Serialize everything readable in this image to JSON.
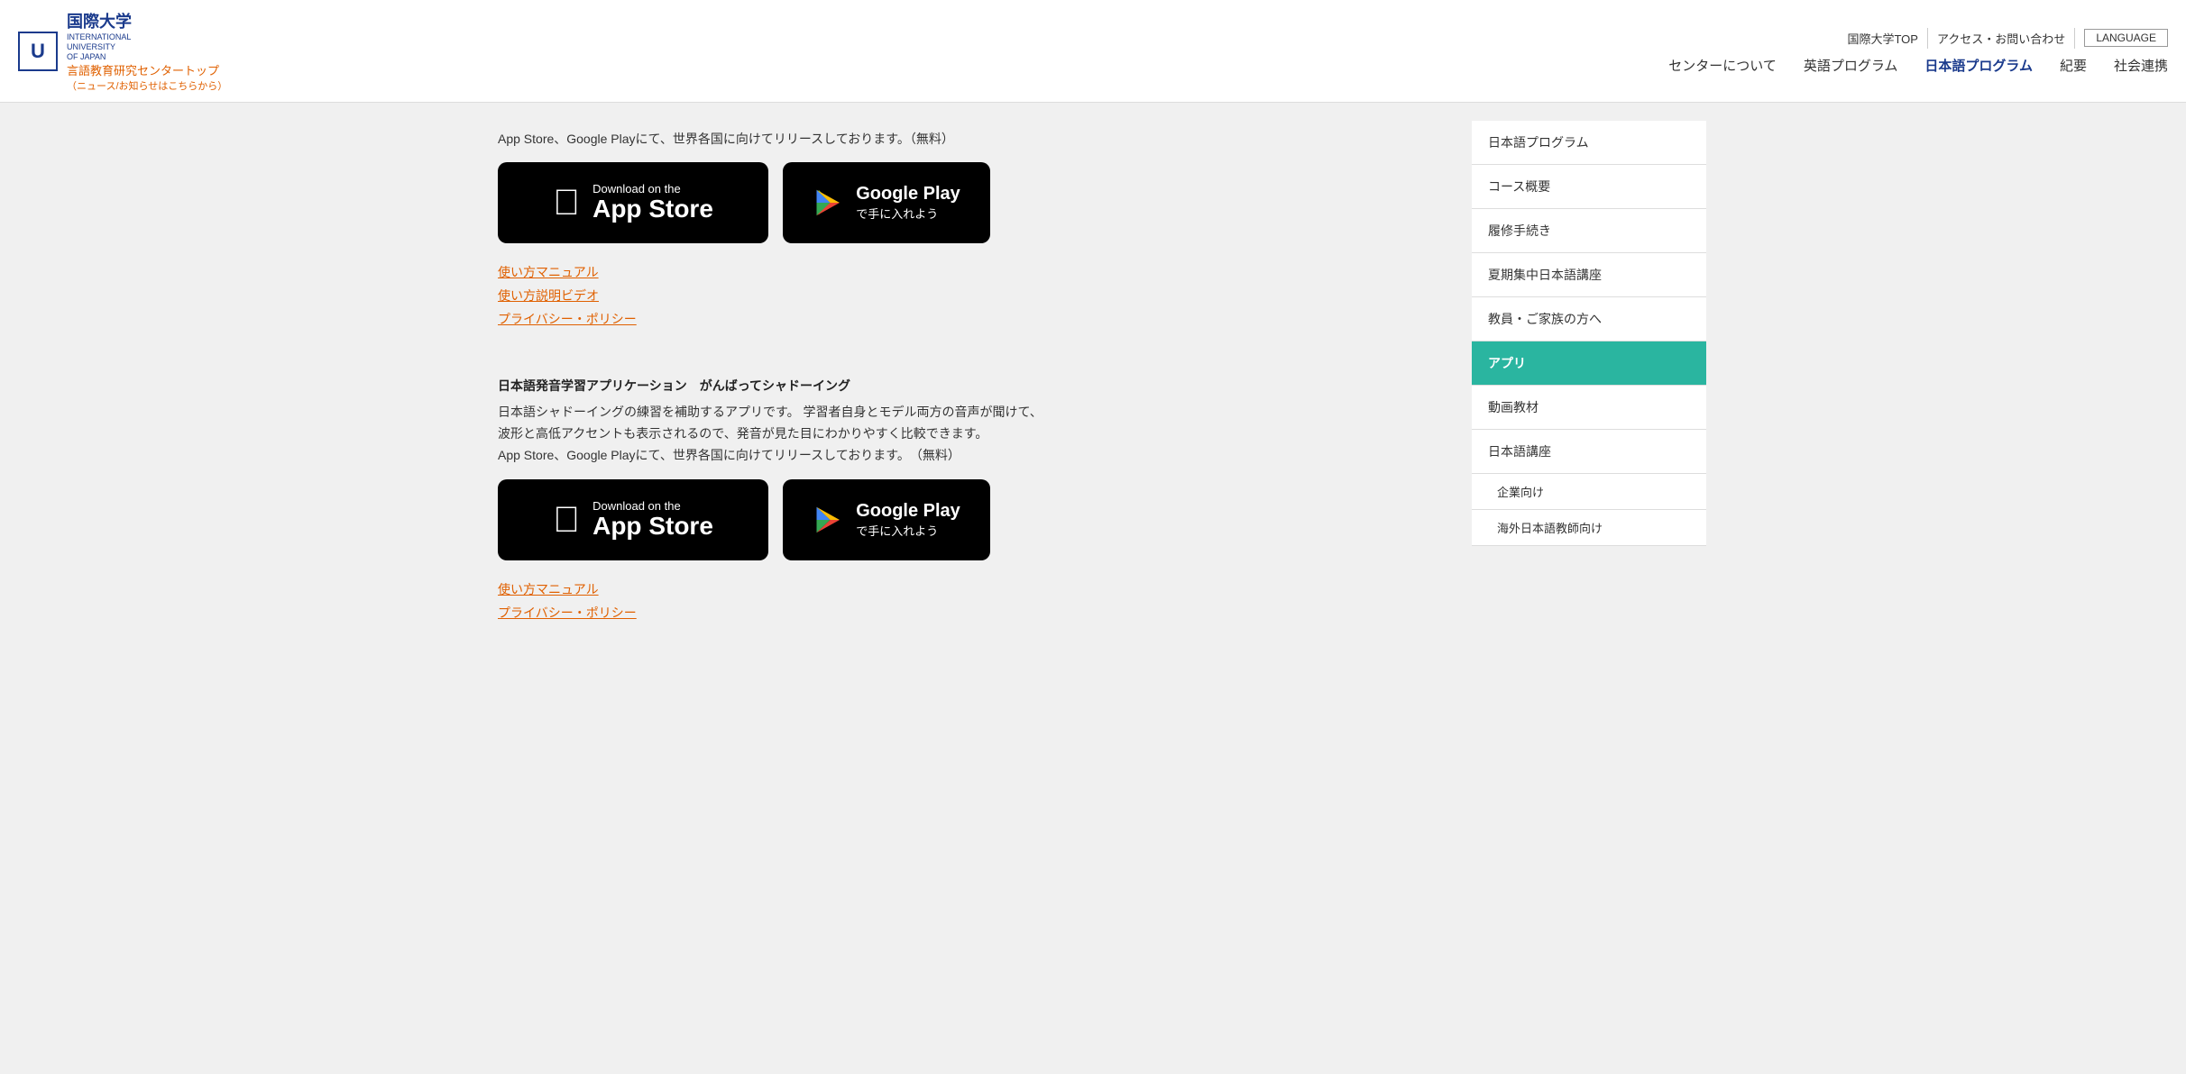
{
  "header": {
    "logo_char": "U",
    "univ_name": "国際大学",
    "univ_en_line1": "INTERNATIONAL",
    "univ_en_line2": "UNIVERSITY",
    "univ_en_line3": "OF JAPAN",
    "center_name": "言語教育研究センタートップ",
    "center_sub": "（ニュース/お知らせはこちらから）",
    "top_links": [
      "国際大学TOP",
      "アクセス・お問い合わせ"
    ],
    "lang_btn": "LANGUAGE",
    "nav": [
      {
        "label": "センターについて",
        "active": false
      },
      {
        "label": "英語プログラム",
        "active": false
      },
      {
        "label": "日本語プログラム",
        "active": true
      },
      {
        "label": "紀要",
        "active": false
      },
      {
        "label": "社会連携",
        "active": false
      }
    ]
  },
  "main": {
    "section1": {
      "intro": "App Store、Google Playにて、世界各国に向けてリリースしております。（無料）",
      "app_store_label_small": "Download on the",
      "app_store_label_big": "App Store",
      "google_play_label_big": "Google Play",
      "google_play_label_small": "で手に入れよう",
      "links": [
        {
          "label": "使い方マニュアル"
        },
        {
          "label": "使い方説明ビデオ"
        },
        {
          "label": "プライバシー・ポリシー"
        }
      ]
    },
    "section2": {
      "title": "日本語発音学習アプリケーション　がんばってシャドーイング",
      "desc_lines": [
        "日本語シャドーイングの練習を補助するアプリです。 学習者自身とモデル両方の音声が聞けて、",
        "波形と高低アクセントも表示されるので、発音が見た目にわかりやすく比較できます。",
        "App Store、Google Playにて、世界各国に向けてリリースしております。　（無料）"
      ],
      "app_store_label_small": "Download on the",
      "app_store_label_big": "App Store",
      "google_play_label_big": "Google Play",
      "google_play_label_small": "で手に入れよう",
      "links": [
        {
          "label": "使い方マニュアル"
        },
        {
          "label": "プライバシー・ポリシー"
        }
      ]
    }
  },
  "sidebar": {
    "items": [
      {
        "label": "日本語プログラム",
        "active": false,
        "sub": false
      },
      {
        "label": "コース概要",
        "active": false,
        "sub": false
      },
      {
        "label": "履修手続き",
        "active": false,
        "sub": false
      },
      {
        "label": "夏期集中日本語講座",
        "active": false,
        "sub": false
      },
      {
        "label": "教員・ご家族の方へ",
        "active": false,
        "sub": false
      },
      {
        "label": "アプリ",
        "active": true,
        "sub": false
      },
      {
        "label": "動画教材",
        "active": false,
        "sub": false
      },
      {
        "label": "日本語講座",
        "active": false,
        "sub": false
      },
      {
        "label": "企業向け",
        "active": false,
        "sub": true
      },
      {
        "label": "海外日本語教師向け",
        "active": false,
        "sub": true
      }
    ]
  }
}
